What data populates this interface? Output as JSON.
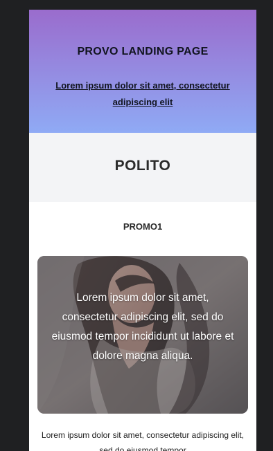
{
  "hero": {
    "title": "PROVO LANDING PAGE",
    "link_text": "Lorem ipsum dolor sit amet, consectetur adipiscing elit",
    "gradient_top": "#9a6ccd",
    "gradient_bottom": "#8faaf5"
  },
  "band": {
    "title": "POLITO",
    "background": "#f3f4f6"
  },
  "promo": {
    "title": "PROMO1",
    "overlay_text": "Lorem ipsum dolor sit amet, consectetur adipiscing elit, sed do eiusmod tempor incididunt ut labore et dolore magna aliqua.",
    "image": "woman-portrait-photo"
  },
  "body": {
    "text": "Lorem ipsum dolor sit amet, consectetur adipiscing elit, sed do eiusmod tempor"
  }
}
